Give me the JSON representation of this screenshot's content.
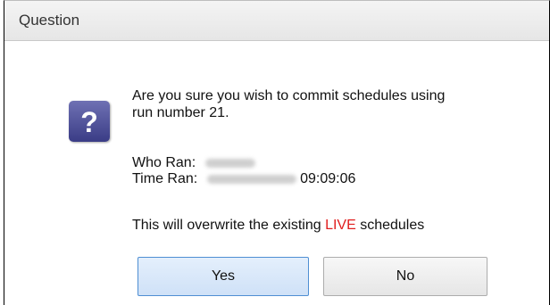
{
  "dialog": {
    "title": "Question",
    "message_line1": "Are you sure you wish to commit schedules using",
    "message_line2": "run number 21.",
    "who_ran_label": "Who Ran:",
    "time_ran_label": "Time Ran:",
    "time_ran_time": "09:09:06",
    "overwrite_prefix": "This will overwrite the existing ",
    "overwrite_live": "LIVE",
    "overwrite_suffix": " schedules",
    "yes_label": "Yes",
    "no_label": "No"
  },
  "colors": {
    "live_text": "#e01e1e",
    "icon_bg": "#4a4c9a",
    "yes_border": "#4f8fd3"
  },
  "icons": {
    "question": "question-mark-icon"
  }
}
